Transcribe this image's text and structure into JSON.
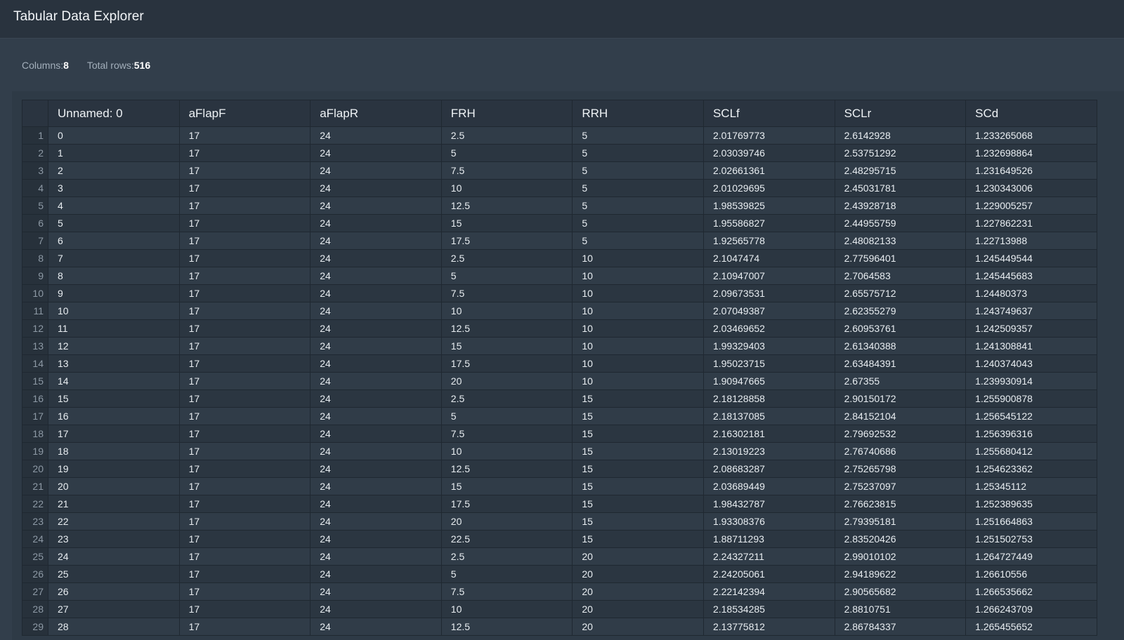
{
  "app": {
    "title": "Tabular Data Explorer"
  },
  "stats": {
    "columns_label": "Columns:",
    "columns_value": "8",
    "rows_label": "Total rows:",
    "rows_value": "516"
  },
  "table": {
    "headers": [
      "Unnamed: 0",
      "aFlapF",
      "aFlapR",
      "FRH",
      "RRH",
      "SCLf",
      "SCLr",
      "SCd"
    ],
    "rows": [
      {
        "index": "1",
        "cells": [
          "0",
          "17",
          "24",
          "2.5",
          "5",
          "2.01769773",
          "2.6142928",
          "1.233265068"
        ]
      },
      {
        "index": "2",
        "cells": [
          "1",
          "17",
          "24",
          "5",
          "5",
          "2.03039746",
          "2.53751292",
          "1.232698864"
        ]
      },
      {
        "index": "3",
        "cells": [
          "2",
          "17",
          "24",
          "7.5",
          "5",
          "2.02661361",
          "2.48295715",
          "1.231649526"
        ]
      },
      {
        "index": "4",
        "cells": [
          "3",
          "17",
          "24",
          "10",
          "5",
          "2.01029695",
          "2.45031781",
          "1.230343006"
        ]
      },
      {
        "index": "5",
        "cells": [
          "4",
          "17",
          "24",
          "12.5",
          "5",
          "1.98539825",
          "2.43928718",
          "1.229005257"
        ]
      },
      {
        "index": "6",
        "cells": [
          "5",
          "17",
          "24",
          "15",
          "5",
          "1.95586827",
          "2.44955759",
          "1.227862231"
        ]
      },
      {
        "index": "7",
        "cells": [
          "6",
          "17",
          "24",
          "17.5",
          "5",
          "1.92565778",
          "2.48082133",
          "1.22713988"
        ]
      },
      {
        "index": "8",
        "cells": [
          "7",
          "17",
          "24",
          "2.5",
          "10",
          "2.1047474",
          "2.77596401",
          "1.245449544"
        ]
      },
      {
        "index": "9",
        "cells": [
          "8",
          "17",
          "24",
          "5",
          "10",
          "2.10947007",
          "2.7064583",
          "1.245445683"
        ]
      },
      {
        "index": "10",
        "cells": [
          "9",
          "17",
          "24",
          "7.5",
          "10",
          "2.09673531",
          "2.65575712",
          "1.24480373"
        ]
      },
      {
        "index": "11",
        "cells": [
          "10",
          "17",
          "24",
          "10",
          "10",
          "2.07049387",
          "2.62355279",
          "1.243749637"
        ]
      },
      {
        "index": "12",
        "cells": [
          "11",
          "17",
          "24",
          "12.5",
          "10",
          "2.03469652",
          "2.60953761",
          "1.242509357"
        ]
      },
      {
        "index": "13",
        "cells": [
          "12",
          "17",
          "24",
          "15",
          "10",
          "1.99329403",
          "2.61340388",
          "1.241308841"
        ]
      },
      {
        "index": "14",
        "cells": [
          "13",
          "17",
          "24",
          "17.5",
          "10",
          "1.95023715",
          "2.63484391",
          "1.240374043"
        ]
      },
      {
        "index": "15",
        "cells": [
          "14",
          "17",
          "24",
          "20",
          "10",
          "1.90947665",
          "2.67355",
          "1.239930914"
        ]
      },
      {
        "index": "16",
        "cells": [
          "15",
          "17",
          "24",
          "2.5",
          "15",
          "2.18128858",
          "2.90150172",
          "1.255900878"
        ]
      },
      {
        "index": "17",
        "cells": [
          "16",
          "17",
          "24",
          "5",
          "15",
          "2.18137085",
          "2.84152104",
          "1.256545122"
        ]
      },
      {
        "index": "18",
        "cells": [
          "17",
          "17",
          "24",
          "7.5",
          "15",
          "2.16302181",
          "2.79692532",
          "1.256396316"
        ]
      },
      {
        "index": "19",
        "cells": [
          "18",
          "17",
          "24",
          "10",
          "15",
          "2.13019223",
          "2.76740686",
          "1.255680412"
        ]
      },
      {
        "index": "20",
        "cells": [
          "19",
          "17",
          "24",
          "12.5",
          "15",
          "2.08683287",
          "2.75265798",
          "1.254623362"
        ]
      },
      {
        "index": "21",
        "cells": [
          "20",
          "17",
          "24",
          "15",
          "15",
          "2.03689449",
          "2.75237097",
          "1.25345112"
        ]
      },
      {
        "index": "22",
        "cells": [
          "21",
          "17",
          "24",
          "17.5",
          "15",
          "1.98432787",
          "2.76623815",
          "1.252389635"
        ]
      },
      {
        "index": "23",
        "cells": [
          "22",
          "17",
          "24",
          "20",
          "15",
          "1.93308376",
          "2.79395181",
          "1.251664863"
        ]
      },
      {
        "index": "24",
        "cells": [
          "23",
          "17",
          "24",
          "22.5",
          "15",
          "1.88711293",
          "2.83520426",
          "1.251502753"
        ]
      },
      {
        "index": "25",
        "cells": [
          "24",
          "17",
          "24",
          "2.5",
          "20",
          "2.24327211",
          "2.99010102",
          "1.264727449"
        ]
      },
      {
        "index": "26",
        "cells": [
          "25",
          "17",
          "24",
          "5",
          "20",
          "2.24205061",
          "2.94189622",
          "1.26610556"
        ]
      },
      {
        "index": "27",
        "cells": [
          "26",
          "17",
          "24",
          "7.5",
          "20",
          "2.22142394",
          "2.90565682",
          "1.266535662"
        ]
      },
      {
        "index": "28",
        "cells": [
          "27",
          "17",
          "24",
          "10",
          "20",
          "2.18534285",
          "2.8810751",
          "1.266243709"
        ]
      },
      {
        "index": "29",
        "cells": [
          "28",
          "17",
          "24",
          "12.5",
          "20",
          "2.13775812",
          "2.86784337",
          "1.265455652"
        ]
      }
    ]
  }
}
